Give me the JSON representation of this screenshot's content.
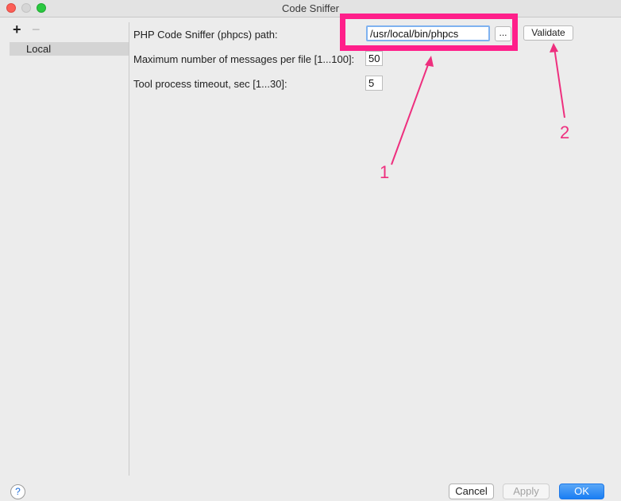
{
  "window": {
    "title": "Code Sniffer"
  },
  "sidebar": {
    "add_label": "+",
    "remove_label": "−",
    "items": [
      {
        "label": "Local"
      }
    ]
  },
  "form": {
    "path_label": "PHP Code Sniffer (phpcs) path:",
    "path_value": "/usr/local/bin/phpcs",
    "browse_label": "...",
    "validate_label": "Validate",
    "max_messages_label": "Maximum number of messages per file [1...100]:",
    "max_messages_value": "50",
    "timeout_label": "Tool process timeout, sec [1...30]:",
    "timeout_value": "5"
  },
  "annotations": {
    "marker_1": "1",
    "marker_2": "2",
    "color": "#ee2f7e"
  },
  "footer": {
    "help_label": "?",
    "cancel_label": "Cancel",
    "apply_label": "Apply",
    "ok_label": "OK"
  }
}
